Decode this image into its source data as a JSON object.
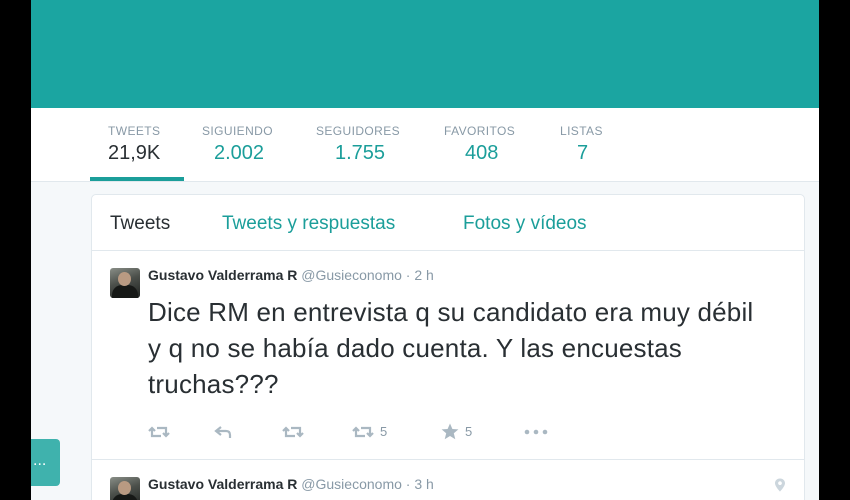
{
  "theme": {
    "accent": "#1b9e9a",
    "banner": "#1ba5a1"
  },
  "profile_nav": {
    "stats": [
      {
        "label": "TWEETS",
        "value": "21,9K"
      },
      {
        "label": "SIGUIENDO",
        "value": "2.002"
      },
      {
        "label": "SEGUIDORES",
        "value": "1.755"
      },
      {
        "label": "FAVORITOS",
        "value": "408"
      },
      {
        "label": "LISTAS",
        "value": "7"
      }
    ]
  },
  "side_button": {
    "label": "..."
  },
  "timeline": {
    "tabs": [
      {
        "label": "Tweets"
      },
      {
        "label": "Tweets y respuestas"
      },
      {
        "label": "Fotos y vídeos"
      }
    ],
    "tweets": [
      {
        "name": "Gustavo Valderrama R",
        "handle": "@Gusieconomo",
        "separator": "·",
        "time": "2 h",
        "text": "Dice RM en entrevista q su candidato era muy débil y q no se había dado cuenta. Y las encuestas truchas???",
        "retweet_count": "5",
        "favorite_count": "5"
      },
      {
        "name": "Gustavo Valderrama R",
        "handle": "@Gusieconomo",
        "separator": "·",
        "time": "3 h"
      }
    ]
  }
}
